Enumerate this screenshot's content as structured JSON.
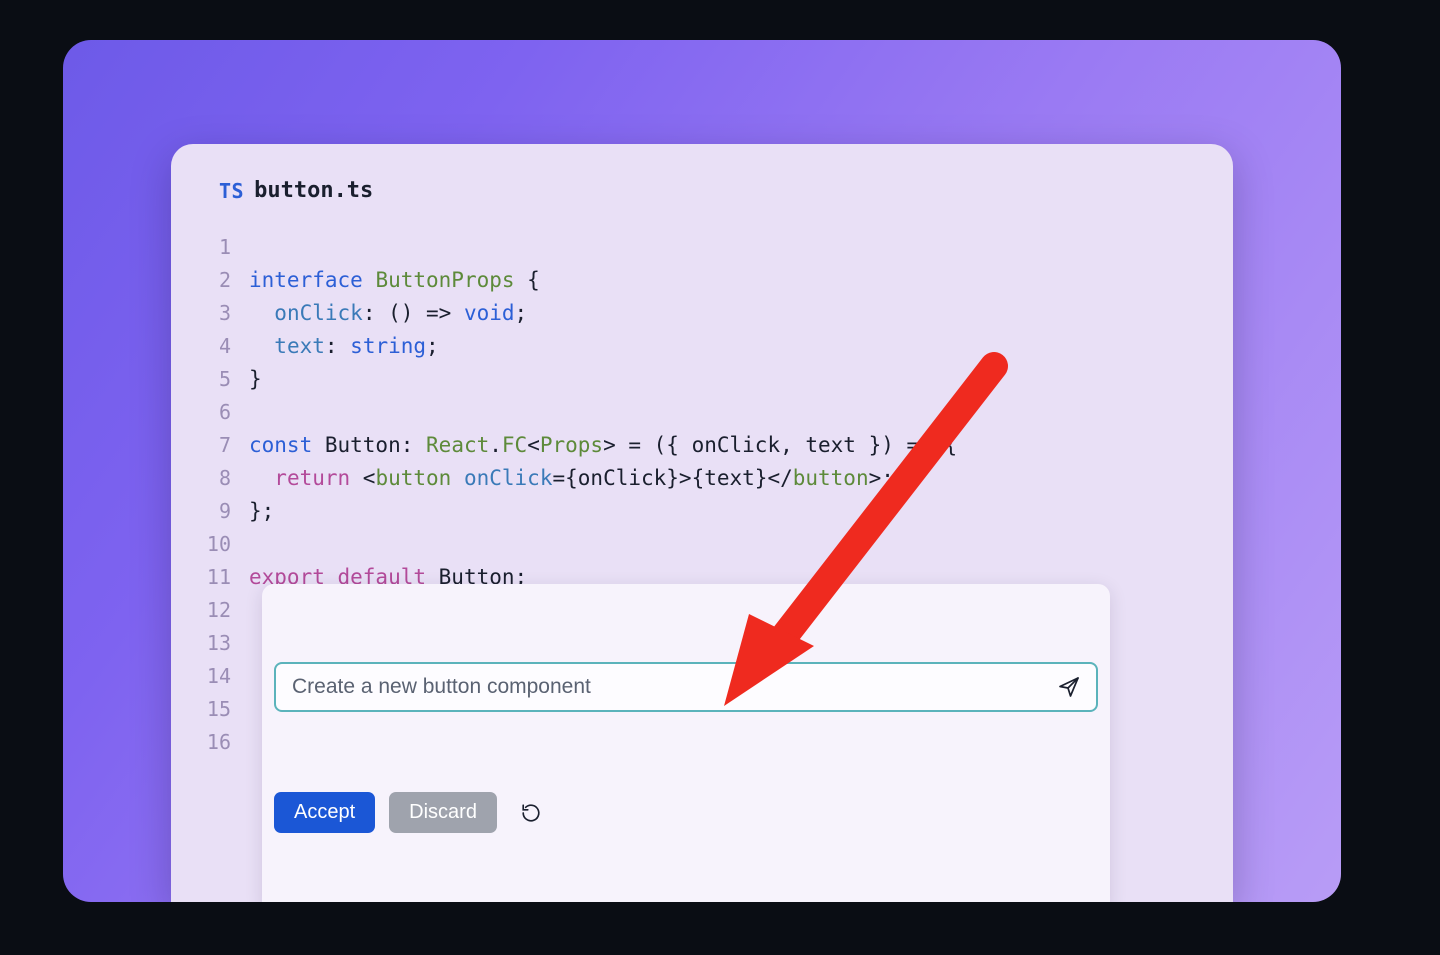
{
  "file": {
    "badge": "TS",
    "name": "button.ts"
  },
  "gutter": {
    "start": 1,
    "end": 16
  },
  "code": {
    "l1_kw": "interface",
    "l1_type": "ButtonProps",
    "l1_brace": " {",
    "l2_prop": "onClick",
    "l2_sig": ": () => ",
    "l2_void": "void",
    "l2_end": ";",
    "l3_prop": "text",
    "l3_sig": ": ",
    "l3_str": "string",
    "l3_end": ";",
    "l4_brace": "}",
    "l6_const": "const",
    "l6_name": " Button",
    "l6_colon": ": ",
    "l6_react": "React",
    "l6_dot": ".",
    "l6_fc": "FC",
    "l6_open": "<",
    "l6_props": "Props",
    "l6_close": ">",
    "l6_rest": " = ({ onClick, text }) => {",
    "l7_return": "return",
    "l7_a": " <",
    "l7_tag1": "button",
    "l7_sp": " ",
    "l7_attr": "onClick",
    "l7_eq": "=",
    "l7_expr": "{onClick}>{text}",
    "l7_b": "</",
    "l7_tag2": "button",
    "l7_c": ">;",
    "l8_brace": "};",
    "l9_export": "export",
    "l9_default": " default",
    "l9_btn": " Button",
    "l9_end": ";"
  },
  "prompt": {
    "value": "Create a new button component"
  },
  "actions": {
    "accept": "Accept",
    "discard": "Discard"
  }
}
